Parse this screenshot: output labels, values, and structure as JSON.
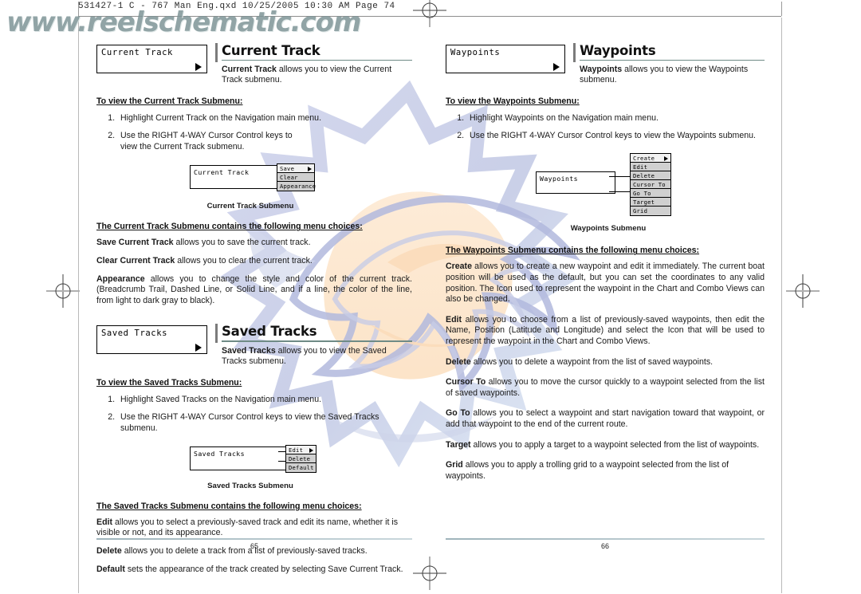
{
  "prepress": {
    "header_text": "531427-1 C - 767 Man Eng.qxd  10/25/2005  10:30 AM  Page 74",
    "watermark_url": "www.reelschematic.com"
  },
  "left_page": {
    "folio": "65",
    "sections": [
      {
        "chip_label": "Current Track",
        "title": "Current Track",
        "desc_bold": "Current Track",
        "desc_rest": " allows you to view the Current Track submenu.",
        "subhead": "To view the Current Track Submenu:",
        "steps": [
          "Highlight Current Track on the Navigation main menu.",
          "Use the RIGHT 4-WAY Cursor Control keys to view the Current Track submenu."
        ],
        "figure": {
          "box_label": "Current Track",
          "menu_items": [
            "Save",
            "Clear",
            "Appearance"
          ],
          "caption": "Current Track Submenu"
        },
        "list_intro": "The Current Track Submenu contains the following menu choices:",
        "items": [
          {
            "term": "Save Current Track",
            "text": " allows you to save the current track."
          },
          {
            "term": "Clear Current Track",
            "text": " allows you to clear the current track."
          },
          {
            "term": "Appearance",
            "text": " allows you to change the style and color of the current track. (Breadcrumb Trail, Dashed Line, or Solid Line, and if a line, the color of the line, from light to dark gray to black)."
          }
        ]
      },
      {
        "chip_label": "Saved Tracks",
        "title": "Saved Tracks",
        "desc_bold": "Saved Tracks",
        "desc_rest": " allows you to view the Saved Tracks submenu.",
        "subhead": "To view the Saved Tracks Submenu:",
        "steps": [
          "Highlight Saved Tracks on the Navigation main menu.",
          "Use the RIGHT 4-WAY Cursor Control keys to view the Saved Tracks submenu."
        ],
        "figure": {
          "box_label": "Saved Tracks",
          "menu_items": [
            "Edit",
            "Delete",
            "Default"
          ],
          "caption": "Saved Tracks Submenu"
        },
        "list_intro": "The Saved Tracks Submenu contains the following menu choices:",
        "items": [
          {
            "term": "Edit",
            "text": " allows you to select a previously-saved track and edit its name, whether it is visible or not, and its appearance."
          },
          {
            "term": "Delete",
            "text": " allows you to delete a track from a list of previously-saved tracks."
          },
          {
            "term": "Default",
            "text": " sets the appearance of the track created by selecting Save Current Track."
          }
        ]
      }
    ]
  },
  "right_page": {
    "folio": "66",
    "sections": [
      {
        "chip_label": "Waypoints",
        "title": "Waypoints",
        "desc_bold": "Waypoints",
        "desc_rest": " allows you to view the Waypoints submenu.",
        "subhead": "To view the Waypoints Submenu:",
        "steps": [
          "Highlight Waypoints on the Navigation main menu.",
          "Use the RIGHT 4-WAY Cursor Control keys to view the Waypoints submenu."
        ],
        "figure": {
          "box_label": "Waypoints",
          "menu_items": [
            "Create",
            "Edit",
            "Delete",
            "Cursor To",
            "Go To",
            "Target",
            "Grid"
          ],
          "caption": "Waypoints Submenu"
        },
        "list_intro": "The Waypoints Submenu contains the following menu choices:",
        "items": [
          {
            "term": "Create",
            "text": " allows you to create a new waypoint and edit it immediately.  The current boat position will be used as the default, but you can set the coordinates to any valid position. The Icon used to represent the waypoint in the Chart and Combo Views can also be changed."
          },
          {
            "term": "Edit",
            "text": " allows you to choose from a list of previously-saved waypoints, then edit the Name, Position (Latitude and Longitude) and select the Icon that will be used to represent the waypoint in the Chart and Combo Views."
          },
          {
            "term": "Delete",
            "text": " allows you to delete a waypoint from the list of saved waypoints."
          },
          {
            "term": "Cursor To",
            "text": " allows you to move the cursor quickly to a waypoint selected from the list of saved waypoints."
          },
          {
            "term": "Go To",
            "text": " allows you to select a waypoint and start navigation toward that waypoint, or add that waypoint to the end of the current route."
          },
          {
            "term": "Target",
            "text": " allows you to apply a target to a waypoint selected from the list of waypoints."
          },
          {
            "term": "Grid",
            "text": " allows you to apply a trolling grid to a waypoint selected from the list of waypoints."
          }
        ]
      }
    ]
  },
  "colors": {
    "heading_rule": "#6f8b86",
    "heading_bar": "#7b7b7b",
    "watermark_text": "#7e9597",
    "bg_art_blue": "#b9bfe0",
    "bg_art_peach": "#fbdfc0"
  }
}
